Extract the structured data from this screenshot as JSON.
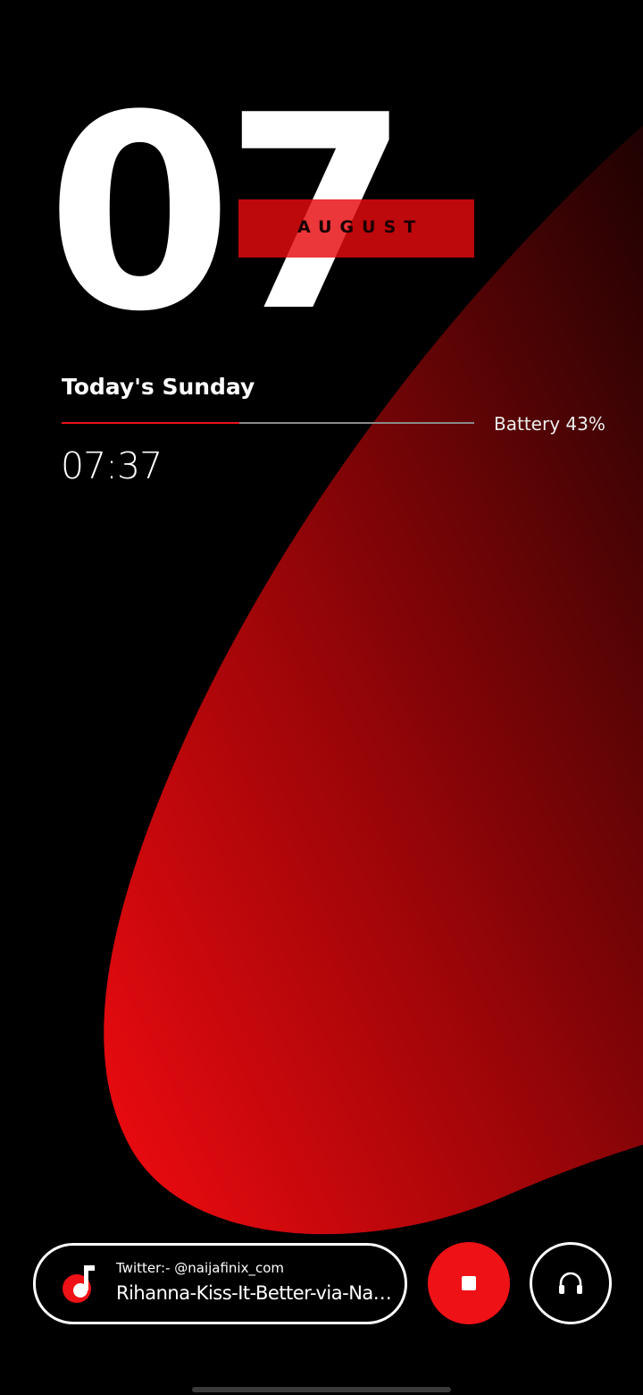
{
  "lockscreen": {
    "date_number": "07",
    "month": "AUGUST",
    "day_text": "Today's Sunday",
    "battery_text": "Battery 43%",
    "battery_level": 0.43,
    "time": "07:37"
  },
  "music": {
    "subtitle": "Twitter:- @naijafinix_com",
    "title": "Rihanna-Kiss-It-Better-via-Naij...",
    "icon": "music-note-icon"
  },
  "controls": {
    "stop_icon": "stop-icon",
    "headset_icon": "headphones-icon"
  },
  "colors": {
    "accent": "#ee1116",
    "background": "#000000",
    "text": "#ffffff"
  }
}
